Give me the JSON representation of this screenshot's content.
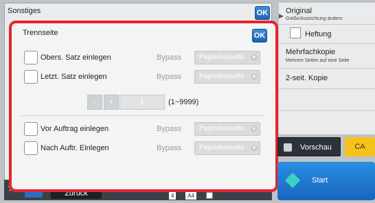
{
  "outer": {
    "title": "Sonstiges",
    "ok_label": "OK",
    "star_icon": "★",
    "down_icon": "▼",
    "back_label": "Zurück",
    "paper_num": "4",
    "paper_size": "A4"
  },
  "dialog": {
    "title": "Trennseite",
    "ok_label": "OK",
    "rows": [
      {
        "label": "Obers. Satz einlegen",
        "bypass": "Bypass",
        "tray": "Papierkassette"
      },
      {
        "label": "Letzt. Satz einlegen",
        "bypass": "Bypass",
        "tray": "Papierkassette"
      },
      {
        "label": "Vor Auftrag einlegen",
        "bypass": "Bypass",
        "tray": "Papierkassette"
      },
      {
        "label": "Nach Auftr. Einlegen",
        "bypass": "Bypass",
        "tray": "Papierkassette"
      }
    ],
    "counter": {
      "minus": "–",
      "plus": "+",
      "value": "1",
      "range": "(1~9999)"
    }
  },
  "right": {
    "original_title": "Original",
    "original_sub": "Größe/Ausrichtung ändern",
    "staple_label": "Heftung",
    "multicopy_title": "Mehrfachkopie",
    "multicopy_sub": "Mehrere Seiten auf eine Seite",
    "duplex_label": "2-seit. Kopie",
    "preview_label": "Vorschau",
    "ca_label": "CA",
    "start_label": "Start"
  },
  "colors": {
    "dialog_border": "#e7242f",
    "ok_blue": "#1f64b3",
    "start_blue": "#1766be",
    "ca_yellow": "#f5c21b"
  }
}
